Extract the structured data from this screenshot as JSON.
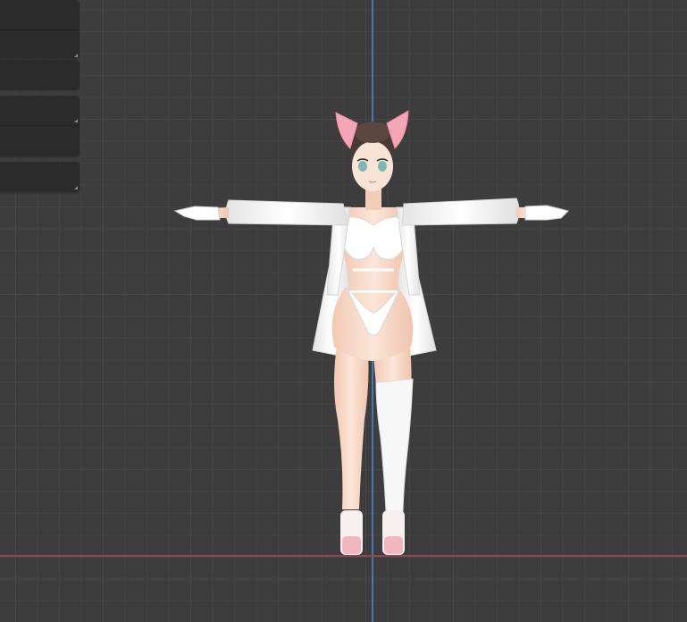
{
  "viewport": {
    "background": "#3d3d3d",
    "grid_color": "#474747",
    "axis_y_color": "#4a74b8",
    "axis_x_color": "#9a4250"
  },
  "panels": [
    {
      "rows": 2
    },
    {
      "rows": 2
    },
    {
      "rows": 1
    }
  ],
  "model": {
    "icon": "avatar-model",
    "pose": "T-pose",
    "skin_color": "#f6d9c8",
    "cloth_color": "#f4f4f4",
    "hair_color": "#4a3a34",
    "ear_color": "#f4a6b6"
  }
}
